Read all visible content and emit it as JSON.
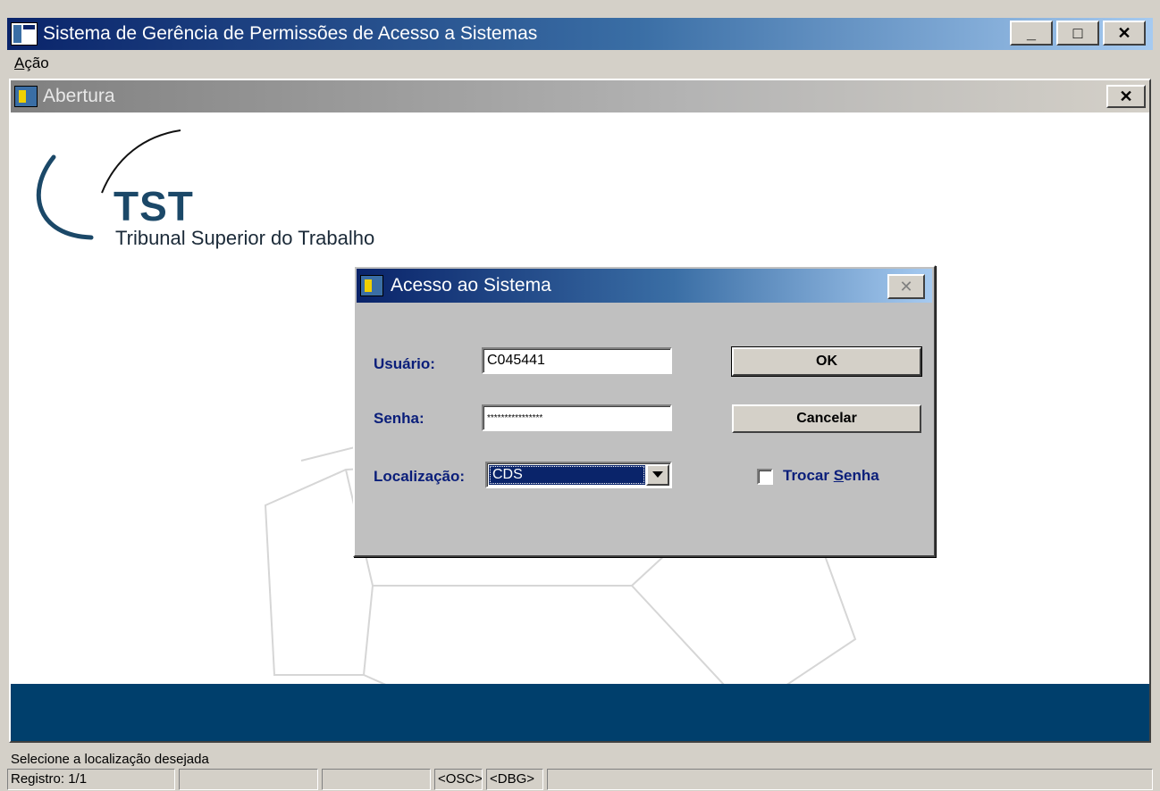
{
  "window": {
    "title": "Sistema de Gerência de Permissões de Acesso a Sistemas",
    "minimize_label": "_",
    "maximize_label": "□",
    "close_label": "✕"
  },
  "menu": {
    "items": [
      {
        "prefix": "",
        "accel": "A",
        "rest": "ção"
      }
    ]
  },
  "child_window": {
    "title": "Abertura",
    "close_label": "✕"
  },
  "logo": {
    "main": "TST",
    "sub": "Tribunal Superior do Trabalho"
  },
  "dialog": {
    "title": "Acesso ao Sistema",
    "close_label": "✕",
    "user_label": "Usuário:",
    "user_value": "C045441",
    "password_label": "Senha:",
    "password_value": "****************",
    "location_label": "Localização:",
    "location_value": "CDS",
    "ok_label": "OK",
    "cancel_label": "Cancelar",
    "change_password": {
      "prefix": "Trocar ",
      "accel": "S",
      "rest": "enha",
      "checked": false
    }
  },
  "status": {
    "message": "Selecione a localização desejada",
    "panels": [
      "Registro: 1/1",
      "",
      "",
      "<OSC>",
      "<DBG>",
      ""
    ]
  },
  "colors": {
    "title_active": "#0a246a",
    "label_blue": "#0a1e7a",
    "band": "#003f6c",
    "logo_text": "#1b4868"
  }
}
